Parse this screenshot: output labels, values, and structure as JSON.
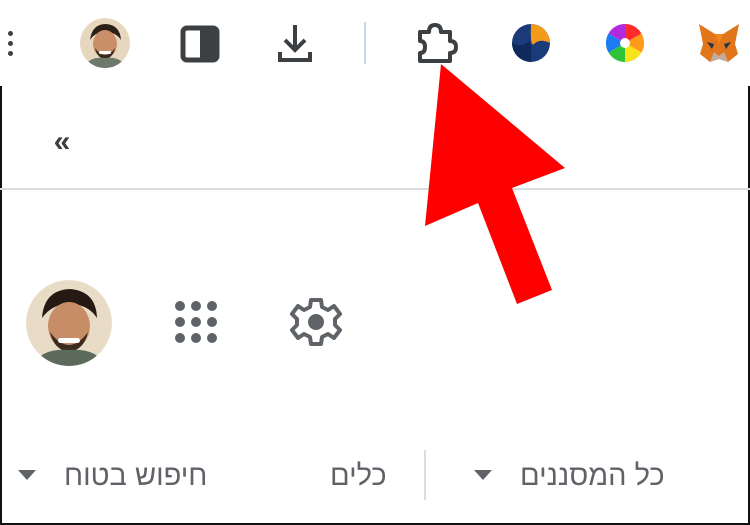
{
  "toolbar": {
    "icons": [
      "menu-icon",
      "profile-avatar",
      "side-panel-icon",
      "download-icon",
      "extensions-icon",
      "s-extension-icon",
      "color-wheel-icon",
      "metamask-fox-icon"
    ]
  },
  "panel": {
    "collapse_label": "«"
  },
  "filters": {
    "safe_search_label": "חיפוש בטוח",
    "tools_label": "כלים",
    "all_filters_label": "כל המסננים"
  },
  "colors": {
    "annotation_arrow": "#ff0000",
    "text_gray": "#5f6368",
    "icon_dark": "#3c4043"
  }
}
